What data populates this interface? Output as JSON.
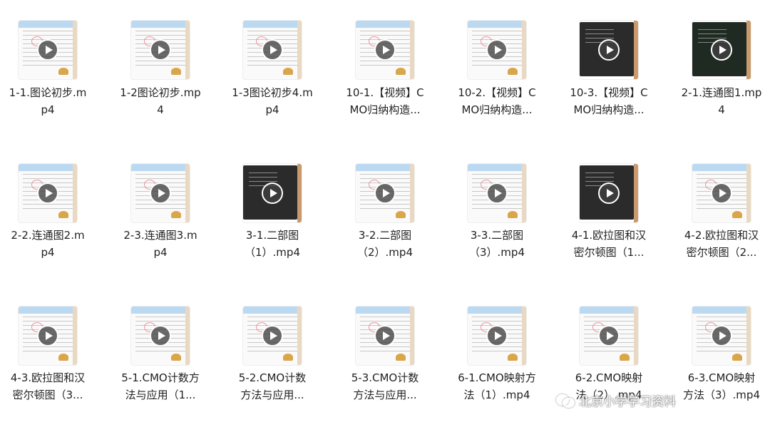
{
  "files": [
    {
      "label_line1": "1-1.图论初步.m",
      "label_line2": "p4",
      "thumbnail": "white"
    },
    {
      "label_line1": "1-2图论初步.mp",
      "label_line2": "4",
      "thumbnail": "white"
    },
    {
      "label_line1": "1-3图论初步4.m",
      "label_line2": "p4",
      "thumbnail": "white"
    },
    {
      "label_line1": "10-1.【视频】C",
      "label_line2": "MO归纳构造...",
      "thumbnail": "white"
    },
    {
      "label_line1": "10-2.【视频】C",
      "label_line2": "MO归纳构造...",
      "thumbnail": "white"
    },
    {
      "label_line1": "10-3.【视频】C",
      "label_line2": "MO归纳构造...",
      "thumbnail": "dark"
    },
    {
      "label_line1": "2-1.连通图1.mp",
      "label_line2": "4",
      "thumbnail": "dark-green"
    },
    {
      "label_line1": "2-2.连通图2.m",
      "label_line2": "p4",
      "thumbnail": "white"
    },
    {
      "label_line1": "2-3.连通图3.m",
      "label_line2": "p4",
      "thumbnail": "white"
    },
    {
      "label_line1": "3-1.二部图",
      "label_line2": "（1）.mp4",
      "thumbnail": "dark"
    },
    {
      "label_line1": "3-2.二部图",
      "label_line2": "（2）.mp4",
      "thumbnail": "white"
    },
    {
      "label_line1": "3-3.二部图",
      "label_line2": "（3）.mp4",
      "thumbnail": "white"
    },
    {
      "label_line1": "4-1.欧拉图和汉",
      "label_line2": "密尔顿图（1...",
      "thumbnail": "dark"
    },
    {
      "label_line1": "4-2.欧拉图和汉",
      "label_line2": "密尔顿图（2...",
      "thumbnail": "white"
    },
    {
      "label_line1": "4-3.欧拉图和汉",
      "label_line2": "密尔顿图（3...",
      "thumbnail": "white"
    },
    {
      "label_line1": "5-1.CMO计数方",
      "label_line2": "法与应用（1...",
      "thumbnail": "white"
    },
    {
      "label_line1": "5-2.CMO计数",
      "label_line2": "方法与应用...",
      "thumbnail": "white"
    },
    {
      "label_line1": "5-3.CMO计数",
      "label_line2": "方法与应用...",
      "thumbnail": "white"
    },
    {
      "label_line1": "6-1.CMO映射方",
      "label_line2": "法（1）.mp4",
      "thumbnail": "white"
    },
    {
      "label_line1": "6-2.CMO映射",
      "label_line2": "法（2）.mp4",
      "thumbnail": "white"
    },
    {
      "label_line1": "6-3.CMO映射",
      "label_line2": "方法（3）.mp4",
      "thumbnail": "white"
    }
  ],
  "watermark": {
    "text": "北京小学学习资料"
  },
  "icons": {
    "play": "play-icon",
    "watermark": "wechat-logo-icon"
  }
}
